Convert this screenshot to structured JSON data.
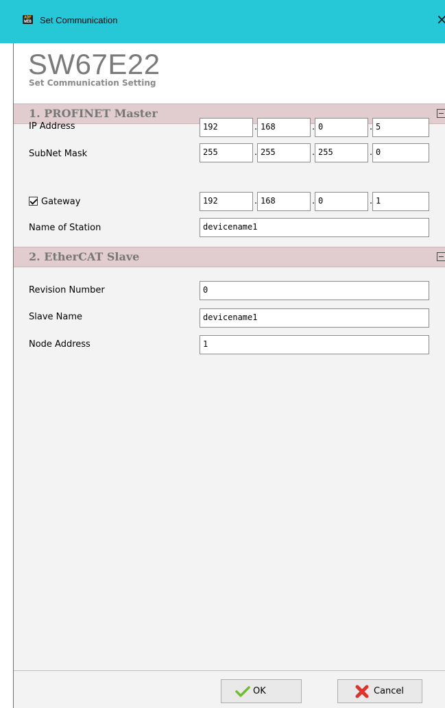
{
  "window": {
    "title": "Set Communication",
    "icon_label": "ADFWEB",
    "close_glyph": "×"
  },
  "header": {
    "title": "SW67E22",
    "subtitle": "Set Communication Setting"
  },
  "sections": {
    "profinet": {
      "title": "1. PROFINET Master",
      "ip_address": {
        "label": "IP Address",
        "octets": [
          "192",
          "168",
          "0",
          "5"
        ]
      },
      "subnet_mask": {
        "label": "SubNet Mask",
        "octets": [
          "255",
          "255",
          "255",
          "0"
        ]
      },
      "gateway": {
        "label": "Gateway",
        "checked": true,
        "octets": [
          "192",
          "168",
          "0",
          "1"
        ]
      },
      "station_name": {
        "label": "Name of Station",
        "value": "devicename1"
      }
    },
    "ethercat": {
      "title": "2. EtherCAT Slave",
      "revision_number": {
        "label": "Revision Number",
        "value": "0"
      },
      "slave_name": {
        "label": "Slave Name",
        "value": "devicename1"
      },
      "node_address": {
        "label": "Node Address",
        "value": "1"
      }
    }
  },
  "buttons": {
    "ok": "OK",
    "cancel": "Cancel"
  },
  "icons": {
    "ok": "checkmark-icon",
    "cancel": "cross-icon",
    "collapse": "minus-box-icon"
  },
  "colors": {
    "titlebar": "#26c7d7",
    "section_bar": "#e1cdd0",
    "ok_check": "#6cbf2a",
    "cancel_cross": "#e0312b"
  }
}
